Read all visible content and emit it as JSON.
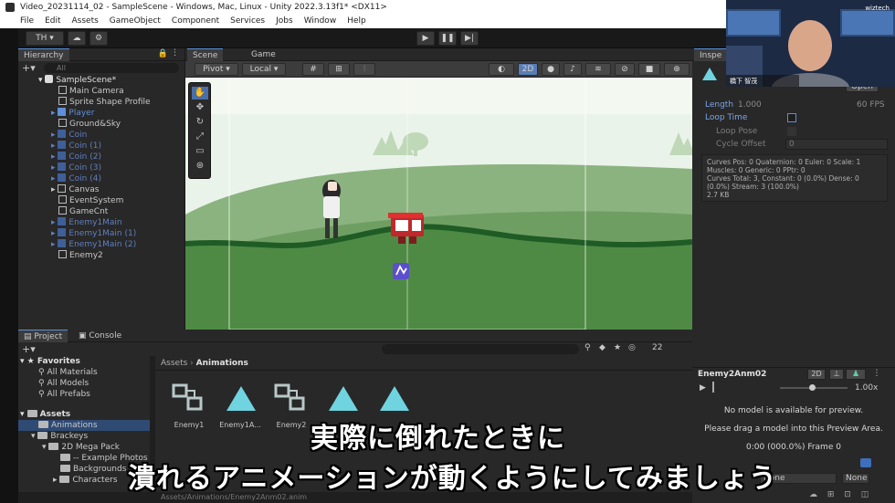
{
  "window": {
    "title": "Video_20231114_02 - SampleScene - Windows, Mac, Linux - Unity 2022.3.13f1* <DX11>"
  },
  "menu": [
    "File",
    "Edit",
    "Assets",
    "GameObject",
    "Component",
    "Services",
    "Jobs",
    "Window",
    "Help"
  ],
  "toolbar": {
    "account": "TH ▾"
  },
  "hierarchy": {
    "tab": "Hierarchy",
    "search_placeholder": "All",
    "scene": "SampleScene*",
    "items": [
      "Main Camera",
      "Sprite Shape Profile",
      "Player",
      "Ground&Sky",
      "Coin",
      "Coin (1)",
      "Coin (2)",
      "Coin (3)",
      "Coin (4)",
      "Canvas",
      "EventSystem",
      "GameCnt",
      "Enemy1Main",
      "Enemy1Main (1)",
      "Enemy1Main (2)",
      "Enemy2"
    ]
  },
  "scene_view": {
    "tabs": [
      "Scene",
      "Game"
    ],
    "pivot": "Pivot",
    "local": "Local",
    "mode_2d": "2D"
  },
  "inspector": {
    "tab": "Inspe",
    "open_button": "Open",
    "length_label": "Length",
    "length_value": "1.000",
    "fps": "60 FPS",
    "loop_time": "Loop Time",
    "loop_pose": "Loop Pose",
    "cycle_offset": "Cycle Offset",
    "cycle_offset_value": "0",
    "stats": [
      "Curves Pos: 0 Quaternion: 0 Euler: 0 Scale: 1",
      "Muscles: 0 Generic: 0 PPtr: 0",
      "Curves Total: 3, Constant: 0 (0.0%) Dense: 0",
      "(0.0%) Stream: 3 (100.0%)",
      "2.7 KB"
    ],
    "preview_name": "Enemy2Anm02",
    "preview_2d": "2D",
    "speed": "1.00x",
    "no_model_1": "No model is available for preview.",
    "no_model_2": "Please drag a model into this Preview Area.",
    "frame": "0:00 (000.0%) Frame 0",
    "none_a": "None",
    "none_b": "None"
  },
  "project": {
    "tabs": [
      "Project",
      "Console"
    ],
    "hidden_count": "22",
    "breadcrumb": [
      "Assets",
      "Animations"
    ],
    "favorites": "Favorites",
    "favorite_items": [
      "All Materials",
      "All Models",
      "All Prefabs"
    ],
    "assets_root": "Assets",
    "tree": [
      "Animations",
      "Brackeys",
      "2D Mega Pack",
      "-- Example Photos",
      "Backgrounds",
      "Characters"
    ],
    "assets": [
      "Enemy1",
      "Enemy1A...",
      "Enemy2",
      "",
      ""
    ],
    "footer_path": "Assets/Animations/Enemy2Anm02.anim"
  },
  "webcam": {
    "brand": "wiztech",
    "name": "橋下 智茂"
  },
  "subtitles": {
    "line1": "実際に倒れたときに",
    "line2": "潰れるアニメーションが動くようにしてみましょう"
  }
}
